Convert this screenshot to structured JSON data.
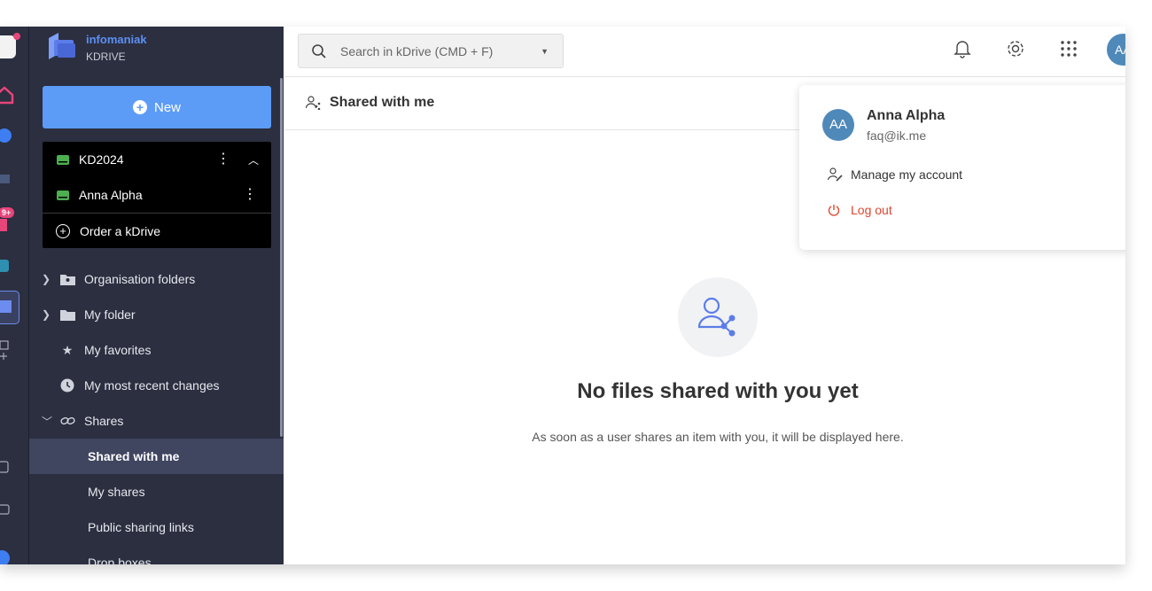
{
  "brand": {
    "name": "infomaniak",
    "product": "KDRIVE"
  },
  "sidebar": {
    "new_label": "New",
    "drives": [
      {
        "name": "KD2024"
      },
      {
        "name": "Anna Alpha"
      }
    ],
    "order_label": "Order a kDrive",
    "nav": [
      {
        "label": "Organisation folders",
        "icon": "org-folder-icon"
      },
      {
        "label": "My folder",
        "icon": "folder-icon"
      },
      {
        "label": "My favorites",
        "icon": "star-icon"
      },
      {
        "label": "My most recent changes",
        "icon": "clock-icon"
      },
      {
        "label": "Shares",
        "icon": "link-icon"
      }
    ],
    "sub_nav": [
      {
        "label": "Shared with me",
        "selected": true
      },
      {
        "label": "My shares"
      },
      {
        "label": "Public sharing links"
      },
      {
        "label": "Drop boxes"
      }
    ],
    "rail_badge": "9+"
  },
  "topbar": {
    "search_placeholder": "Search in kDrive (CMD + F)",
    "avatar_initials": "AA"
  },
  "page": {
    "title": "Shared with me",
    "empty_title": "No files shared with you yet",
    "empty_desc": "As soon as a user shares an item with you, it will be displayed here."
  },
  "account_menu": {
    "initials": "AA",
    "name": "Anna Alpha",
    "email": "faq@ik.me",
    "manage_label": "Manage my account",
    "logout_label": "Log out"
  },
  "colors": {
    "accent": "#5c9cf7",
    "sidebar": "#2b2f40",
    "logout": "#e0462f",
    "avatar": "#4f89b9",
    "drive_green": "#4caf50"
  }
}
